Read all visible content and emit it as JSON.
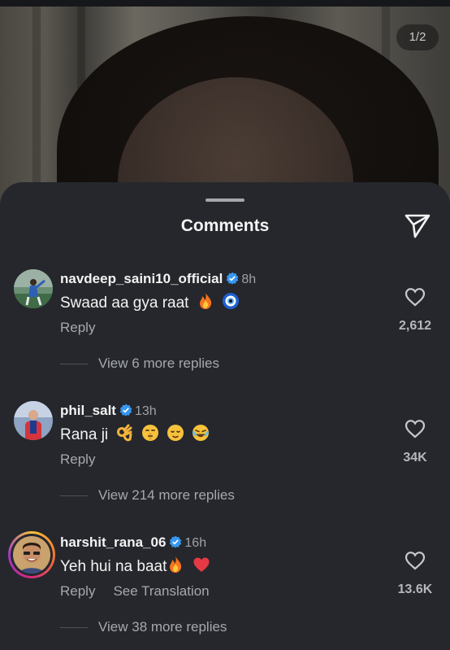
{
  "story": {
    "counter": "1/2"
  },
  "sheet": {
    "title": "Comments",
    "send_icon": "paper-plane-icon"
  },
  "comments": [
    {
      "username": "navdeep_saini10_official",
      "verified": true,
      "time": "8h",
      "text": "Swaad aa gya raat",
      "emojis": [
        "fire",
        "nazar-amulet"
      ],
      "reply_label": "Reply",
      "like_count": "2,612",
      "view_replies": "View 6 more replies"
    },
    {
      "username": "phil_salt",
      "verified": true,
      "time": "13h",
      "text": "Rana ji",
      "emojis": [
        "ok-hand",
        "shushing-face",
        "relieved-face",
        "joy-face"
      ],
      "reply_label": "Reply",
      "like_count": "34K",
      "view_replies": "View 214 more replies"
    },
    {
      "username": "harshit_rana_06",
      "verified": true,
      "time": "16h",
      "text": "Yeh hui na baat",
      "emojis": [
        "fire",
        "red-heart"
      ],
      "reply_label": "Reply",
      "translate_label": "See Translation",
      "like_count": "13.6K",
      "view_replies": "View 38 more replies",
      "has_story_ring": true
    }
  ],
  "colors": {
    "sheet_bg": "#25272c",
    "verified_blue": "#3797f0",
    "muted_text": "#a5a8ad"
  }
}
